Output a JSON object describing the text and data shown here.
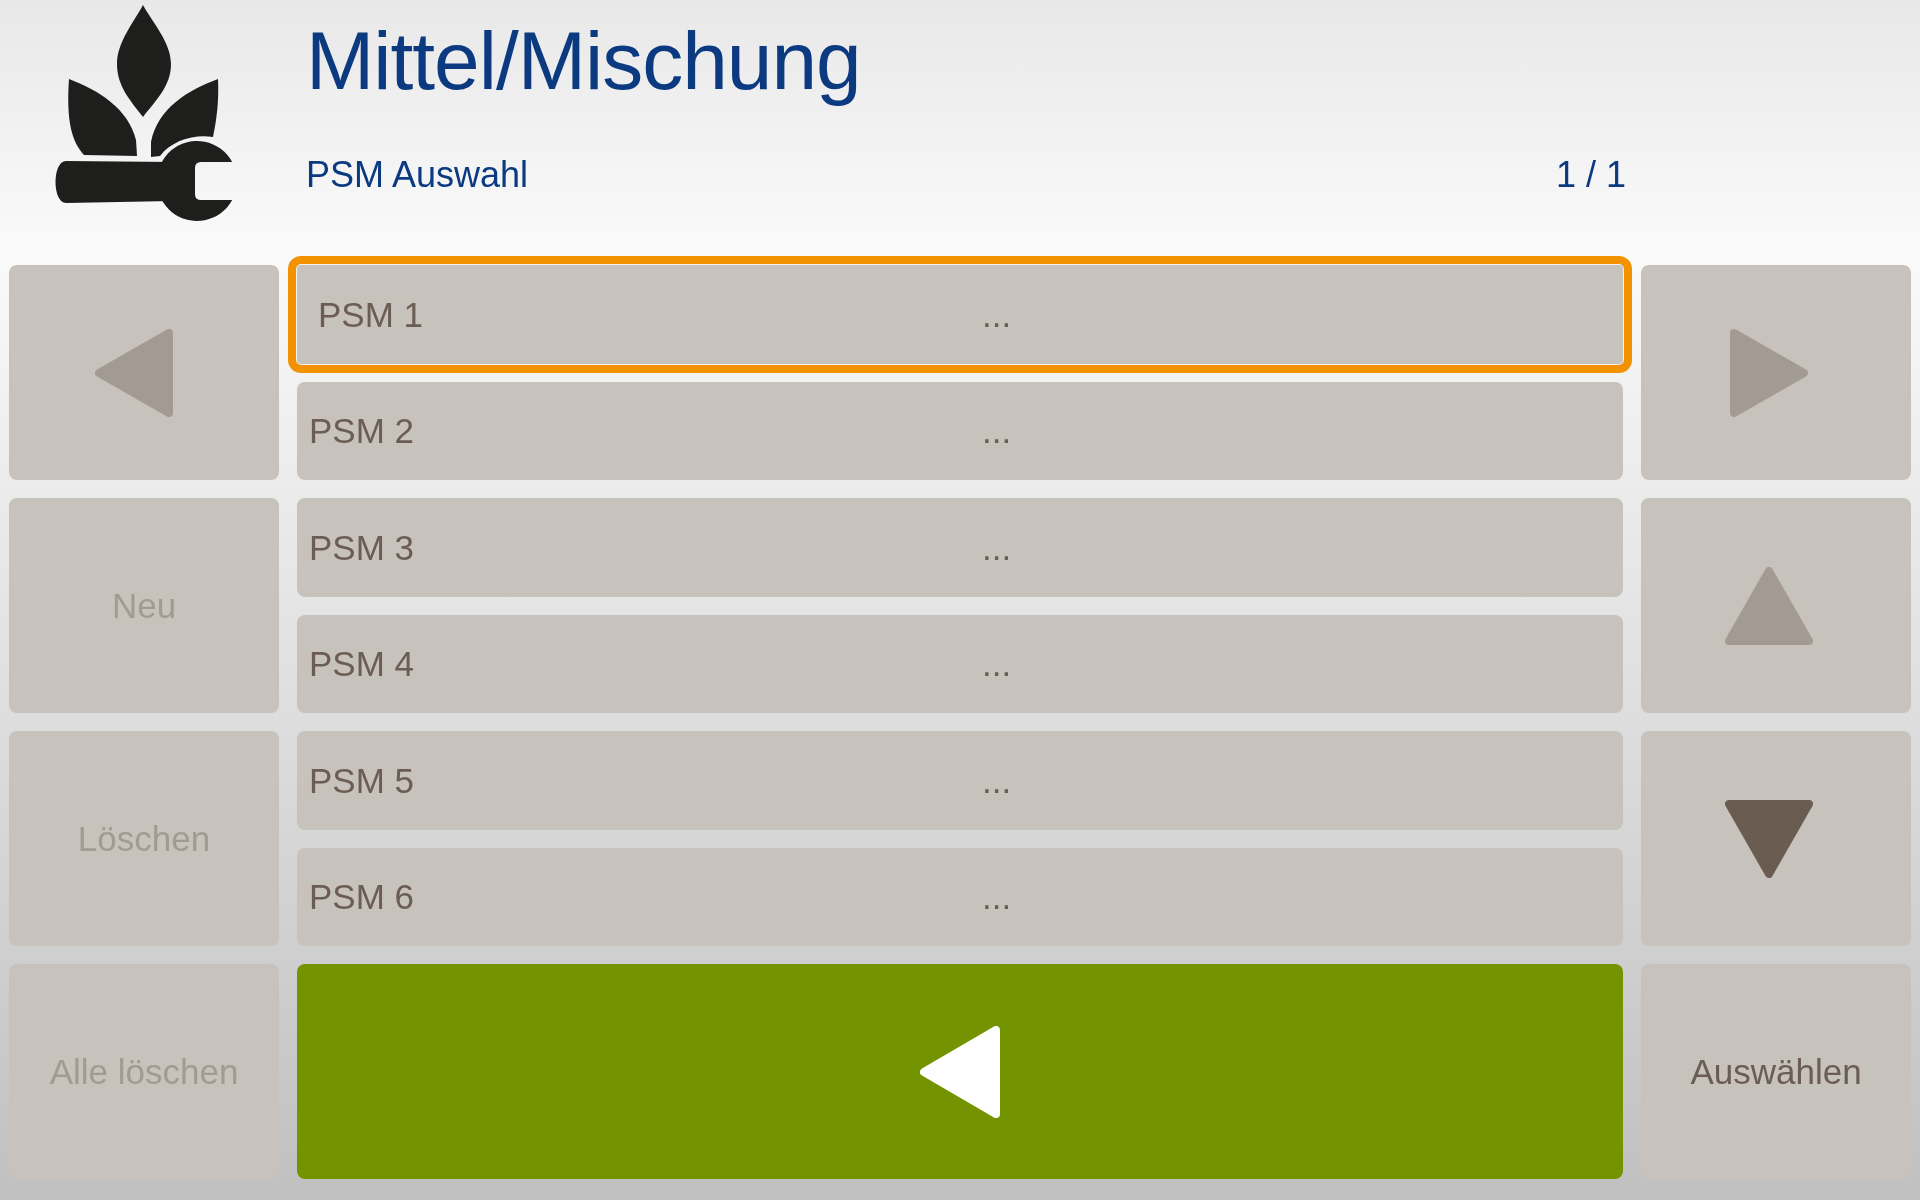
{
  "header": {
    "title": "Mittel/Mischung",
    "subtitle": "PSM Auswahl",
    "page": "1 / 1"
  },
  "left_buttons": [
    {
      "kind": "left",
      "disabled": true
    },
    {
      "kind": "text",
      "label": "Neu",
      "disabled": true
    },
    {
      "kind": "text",
      "label": "Löschen",
      "disabled": true
    },
    {
      "kind": "text",
      "label": "Alle löschen",
      "disabled": true
    }
  ],
  "list": {
    "rows": [
      {
        "name": "PSM 1",
        "value": "...",
        "selected": true
      },
      {
        "name": "PSM 2",
        "value": "...",
        "selected": false
      },
      {
        "name": "PSM 3",
        "value": "...",
        "selected": false
      },
      {
        "name": "PSM 4",
        "value": "...",
        "selected": false
      },
      {
        "name": "PSM 5",
        "value": "...",
        "selected": false
      },
      {
        "name": "PSM 6",
        "value": "...",
        "selected": false
      }
    ]
  },
  "right_buttons": [
    {
      "kind": "right",
      "disabled": true
    },
    {
      "kind": "up",
      "disabled": true
    },
    {
      "kind": "down",
      "disabled": false
    },
    {
      "kind": "text",
      "label": "Auswählen",
      "disabled": false
    }
  ]
}
